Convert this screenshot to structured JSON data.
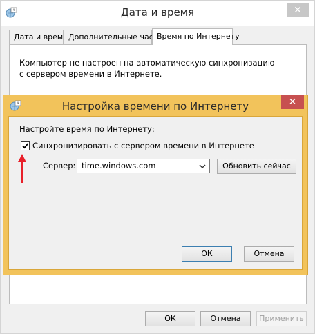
{
  "window": {
    "title": "Дата и время",
    "close_glyph": "✕",
    "tabs": [
      {
        "label": "Дата и время"
      },
      {
        "label": "Дополнительные часы"
      },
      {
        "label": "Время по Интернету"
      }
    ],
    "active_tab": 2,
    "panel_text": "Компьютер не настроен на автоматическую синхронизацию с сервером времени в Интернете.",
    "buttons": {
      "ok": "ОК",
      "cancel": "Отмена",
      "apply": "Применить"
    }
  },
  "dialog": {
    "title": "Настройка времени по Интернету",
    "close_glyph": "✕",
    "heading": "Настройте время по Интернету:",
    "sync_checkbox": {
      "label": "Синхронизировать с сервером времени в Интернете",
      "checked": true
    },
    "server_label": "Сервер:",
    "server_value": "time.windows.com",
    "update_now": "Обновить сейчас",
    "ok": "ОК",
    "cancel": "Отмена"
  },
  "colors": {
    "dialog_frame": "#f2c35b",
    "close_active": "#c75050",
    "annotation_arrow": "#e8202a"
  },
  "icons": [
    "clock-globe-icon",
    "close-icon",
    "checkmark-icon",
    "dropdown-arrow-icon",
    "red-arrow-icon"
  ]
}
